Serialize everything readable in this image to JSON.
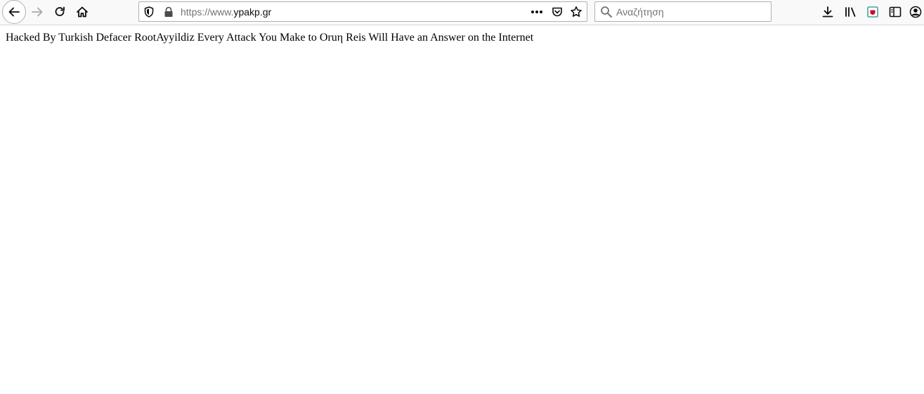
{
  "browser": {
    "url_prefix": "https://www.",
    "url_host": "ypakp.gr",
    "search_placeholder": "Αναζήτηση",
    "search_value": ""
  },
  "page": {
    "text": "Hacked By Turkish Defacer RootAyyildiz Every Attack You Make to Oruη Reis Will Have an Answer on the Internet"
  },
  "colors": {
    "toolbar_bg": "#f9f9fa",
    "icon": "#0c0c0d",
    "disabled_icon": "#a8a8a8",
    "pocket_accent": "#3fa79b"
  }
}
